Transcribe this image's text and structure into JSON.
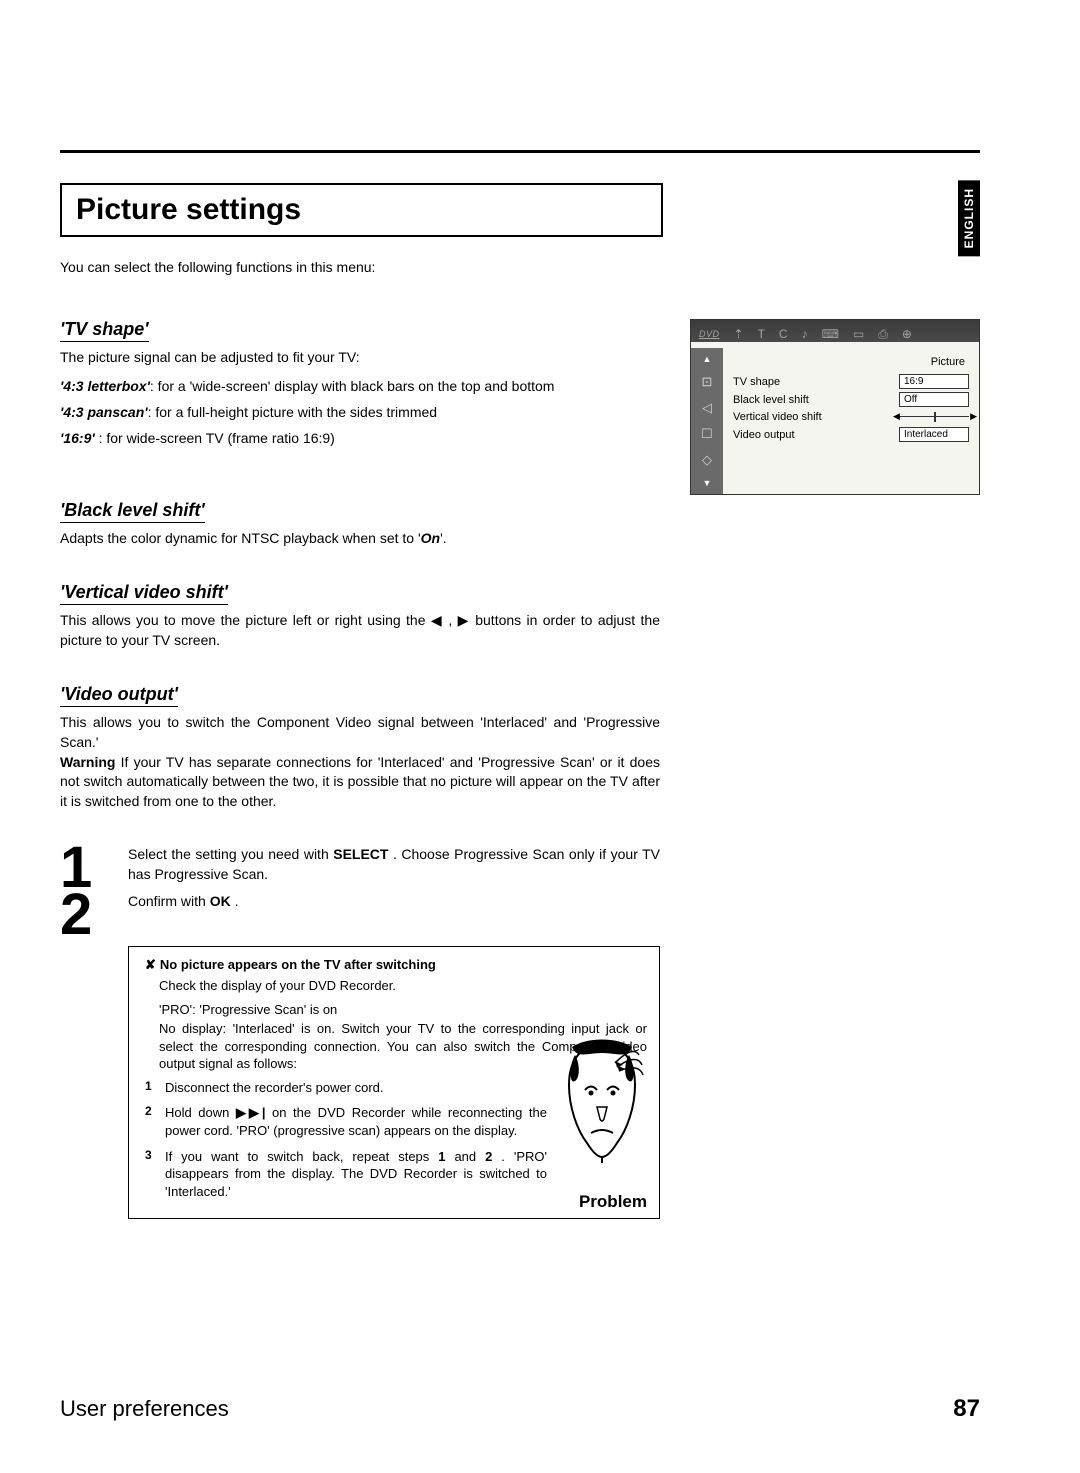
{
  "lang_tab": "ENGLISH",
  "title": "Picture settings",
  "intro": "You can select the following functions in this menu:",
  "sections": {
    "tvshape": {
      "heading": "'TV shape'",
      "lead": "The picture signal can be adjusted to fit your TV:",
      "items": [
        {
          "term": "'4:3 letterbox'",
          "desc": ":   for a 'wide-screen' display with black bars on the top and bottom"
        },
        {
          "term": "'4:3 panscan'",
          "desc": ":   for a full-height picture with the sides trimmed"
        },
        {
          "term": "'16:9'",
          "desc": " :   for wide-screen TV (frame ratio 16:9)"
        }
      ]
    },
    "black": {
      "heading": "'Black level shift'",
      "body_pre": "Adapts the color dynamic for NTSC playback when set to '",
      "body_em": "On",
      "body_post": "'."
    },
    "vert": {
      "heading": "'Vertical video shift'",
      "body": "This allows you to move the picture left or right using the  ◀ ,  ▶  buttons in order to adjust the picture to your TV screen."
    },
    "vout": {
      "heading": "'Video output'",
      "body": "This allows you to switch the Component Video signal between 'Interlaced' and 'Progressive Scan.'",
      "warning_label": "Warning",
      "warning_body": " If your TV has separate connections for 'Interlaced' and 'Progressive Scan' or it does not switch automatically between the two, it is possible that no picture will appear on the TV after it is switched from one to the other."
    }
  },
  "osd": {
    "dvd": "DVD",
    "top_icons": [
      "⇡",
      "T",
      "C",
      "♪",
      "⌨",
      "▭",
      "⎙",
      "⊕"
    ],
    "side_icons": [
      "⊡",
      "◁",
      "☐",
      "◇"
    ],
    "panel_title": "Picture",
    "rows": [
      {
        "label": "TV shape",
        "value": "16:9"
      },
      {
        "label": "Black level shift",
        "value": "Off"
      },
      {
        "label": "Vertical video shift",
        "slider": true
      },
      {
        "label": "Video output",
        "value": "Interlaced"
      }
    ]
  },
  "steps": [
    {
      "n": "1",
      "text_pre": "Select the setting you need with ",
      "btn1": "SELECT",
      "text_post": " . Choose Progressive Scan only if your TV has Progressive Scan."
    },
    {
      "n": "2",
      "text_pre": "Confirm with ",
      "btn1": "OK",
      "text_post": " ."
    }
  ],
  "problem": {
    "x": "✘",
    "headline": "No picture appears on the TV after switching",
    "lines": [
      "Check the display of your DVD Recorder.",
      "'PRO': 'Progressive Scan' is on",
      "No display: 'Interlaced' is on. Switch your TV to the corresponding input jack or select the corresponding connection. You can also switch the Component video output signal as follows:"
    ],
    "items": [
      {
        "n": "1",
        "t": "Disconnect the recorder's power cord."
      },
      {
        "n": "2",
        "t_pre": "Hold down  ",
        "icon": "▶▶|",
        "t_post": " on the DVD Recorder while reconnecting the power cord. 'PRO' (progressive scan) appears on the display."
      },
      {
        "n": "3",
        "t_pre": "If you want to switch back, repeat steps ",
        "b1": "1",
        "t_mid": " and ",
        "b2": "2",
        "t_post": " . 'PRO' disappears from the display. The DVD Recorder is switched to 'Interlaced.'"
      }
    ],
    "label": "Problem"
  },
  "footer": {
    "title": "User preferences",
    "page": "87"
  }
}
